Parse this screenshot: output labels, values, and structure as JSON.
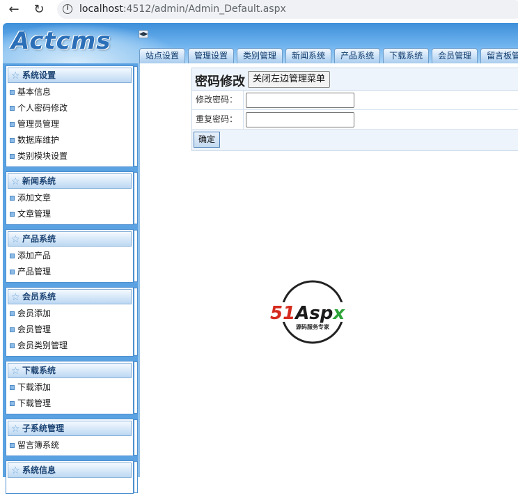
{
  "browser": {
    "url_host": "localhost",
    "url_rest": ":4512/admin/Admin_Default.aspx"
  },
  "header": {
    "logo": "Actcms",
    "tabs": [
      "站点设置",
      "管理设置",
      "类别管理",
      "新闻系统",
      "产品系统",
      "下载系统",
      "会员管理",
      "留言板管"
    ]
  },
  "sidebar": {
    "groups": [
      {
        "title": "系统设置",
        "items": [
          "基本信息",
          "个人密码修改",
          "管理员管理",
          "数据库维护",
          "类别模块设置"
        ]
      },
      {
        "title": "新闻系统",
        "items": [
          "添加文章",
          "文章管理"
        ]
      },
      {
        "title": "产品系统",
        "items": [
          "添加产品",
          "产品管理"
        ]
      },
      {
        "title": "会员系统",
        "items": [
          "会员添加",
          "会员管理",
          "会员类别管理"
        ]
      },
      {
        "title": "下载系统",
        "items": [
          "下载添加",
          "下载管理"
        ]
      },
      {
        "title": "子系统管理",
        "items": [
          "留言簿系统"
        ]
      },
      {
        "title": "系统信息",
        "items": []
      }
    ]
  },
  "main": {
    "title": "密码修改",
    "close_menu_label": "关闭左边管理菜单",
    "fields": [
      {
        "label": "修改密码：",
        "value": ""
      },
      {
        "label": "重复密码：",
        "value": ""
      }
    ],
    "submit_label": "确定"
  },
  "watermark": {
    "brand_red": "51",
    "brand_dark": "Asp",
    "brand_green": "x",
    "tagline": "源码服务专家"
  }
}
